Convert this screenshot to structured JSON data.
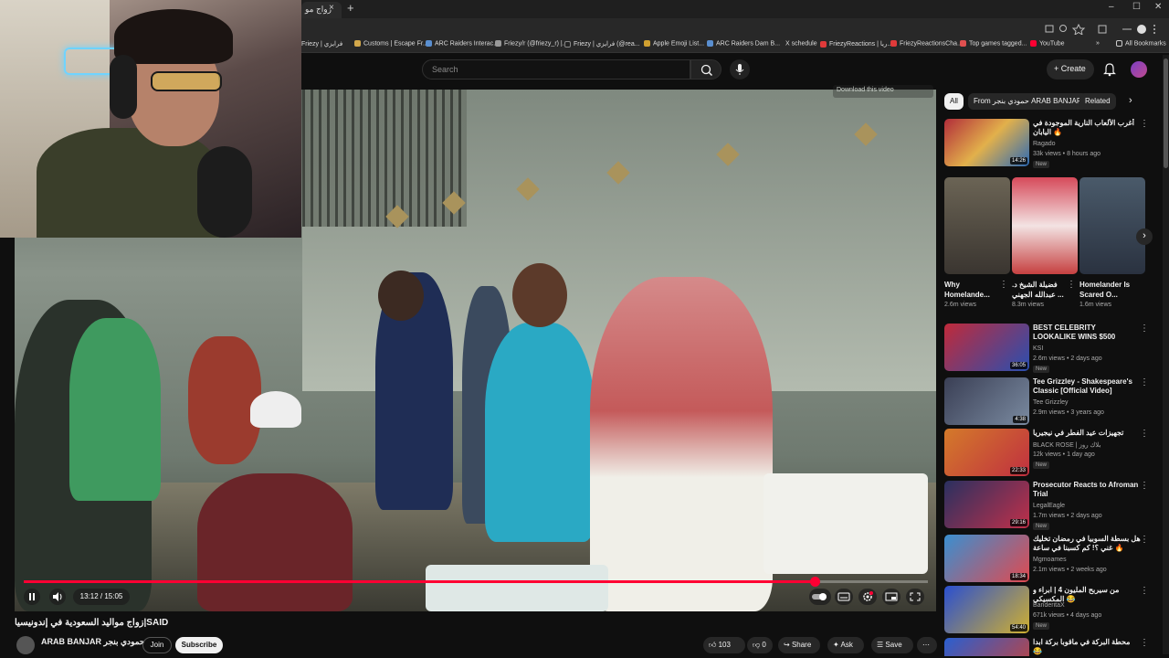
{
  "browser": {
    "tab_title": "رواج مو",
    "tab_close": "×",
    "new_tab": "+",
    "window_controls": [
      "–",
      "☐",
      "✕"
    ],
    "bookmarks": [
      {
        "label": "Friezy | فرايزي",
        "color": "#e8e8e8"
      },
      {
        "label": "Customs | Escape Fr...",
        "color": "#d3a84b"
      },
      {
        "label": "ARC Raiders Interac...",
        "color": "#5a8fd0"
      },
      {
        "label": "Friezy/r (@friezy_r) |...",
        "color": "#999999"
      },
      {
        "label": "Friezy | فرايزي (@rea...",
        "color": "#222222"
      },
      {
        "label": "Apple Emoji List...",
        "color": "#d0a030"
      },
      {
        "label": "ARC Raiders Dam B...",
        "color": "#5a8fd0"
      },
      {
        "label": "X schedule",
        "color": "#ffffff"
      },
      {
        "label": "FriezyReactions | ريا...",
        "color": "#e03a3a"
      },
      {
        "label": "FriezyReactionsCha...",
        "color": "#e03a3a"
      },
      {
        "label": "Top games tagged...",
        "color": "#e05050"
      },
      {
        "label": "YouTube",
        "color": "#ff0033"
      }
    ],
    "all_bookmarks": "All Bookmarks"
  },
  "header": {
    "search_placeholder": "Search",
    "create_label": "Create"
  },
  "player": {
    "download_hint": "Download this video",
    "current_time": "13:12",
    "duration": "15:05",
    "progress_fraction": 0.875,
    "accent_color": "#ff0033"
  },
  "video": {
    "title": "زواج مواليد السعودية في إندونيسيا|SAID",
    "channel_name": "ARAB BANJAR حمودي بنجر",
    "channel_sub": "",
    "join_label": "Join",
    "subscribe_label": "Subscribe",
    "likes": "103",
    "dislikes": "0",
    "share_label": "Share",
    "ask_label": "Ask",
    "save_label": "Save"
  },
  "sidebar": {
    "chips": [
      {
        "label": "All",
        "active": true
      },
      {
        "label": "From حمودي بنجر ARAB BANJAR",
        "active": false
      },
      {
        "label": "Related",
        "active": false
      }
    ],
    "first_rec": {
      "title": "أغرب الألعاب النارية الموجودة في اليابان 🔥",
      "channel": "Ragado",
      "meta": "33k views • 8 hours ago",
      "new": "New",
      "duration": "14:26"
    },
    "shorts": [
      {
        "title": "Why Homelande...",
        "views": "2.6m views"
      },
      {
        "title": "فضيلة الشيخ د. عبدالله الجهني ...",
        "views": "8.3m views"
      },
      {
        "title": "Homelander Is Scared O...",
        "views": "1.6m views"
      }
    ],
    "recs": [
      {
        "title": "BEST CELEBRITY LOOKALIKE WINS $500",
        "channel": "KSI",
        "meta": "2.6m views • 2 days ago",
        "new": "New",
        "duration": "36:05"
      },
      {
        "title": "Tee Grizzley - Shakespeare's Classic [Official Video]",
        "channel": "Tee Grizzley",
        "meta": "2.9m views • 3 years ago",
        "new": "",
        "duration": "4:38"
      },
      {
        "title": "تجهيزات عيد الفطر في نيجيريا",
        "channel": "BLACK ROSE | بلاك روز",
        "meta": "12k views • 1 day ago",
        "new": "New",
        "duration": "22:33"
      },
      {
        "title": "Prosecutor Reacts to Afroman Trial",
        "channel": "LegalEagle",
        "meta": "1.7m views • 2 days ago",
        "new": "New",
        "duration": "29:16"
      },
      {
        "title": "هل بسطة السوبيا في رمضان تخليك غني ؟! كم كسبنا في ساعة 🔥",
        "channel": "Mgmoames",
        "meta": "2.1m views • 2 weeks ago",
        "new": "",
        "duration": "18:34"
      },
      {
        "title": "من سيربح المليون 4 | ابراء و المكسيكي 😂",
        "channel": "BanderitaX",
        "meta": "671k views • 4 days ago",
        "new": "New",
        "duration": "54:40"
      },
      {
        "title": "محطة البركة في ماقوبا بركة ابدا 😂",
        "channel": "",
        "meta": "",
        "new": "",
        "duration": ""
      }
    ]
  }
}
